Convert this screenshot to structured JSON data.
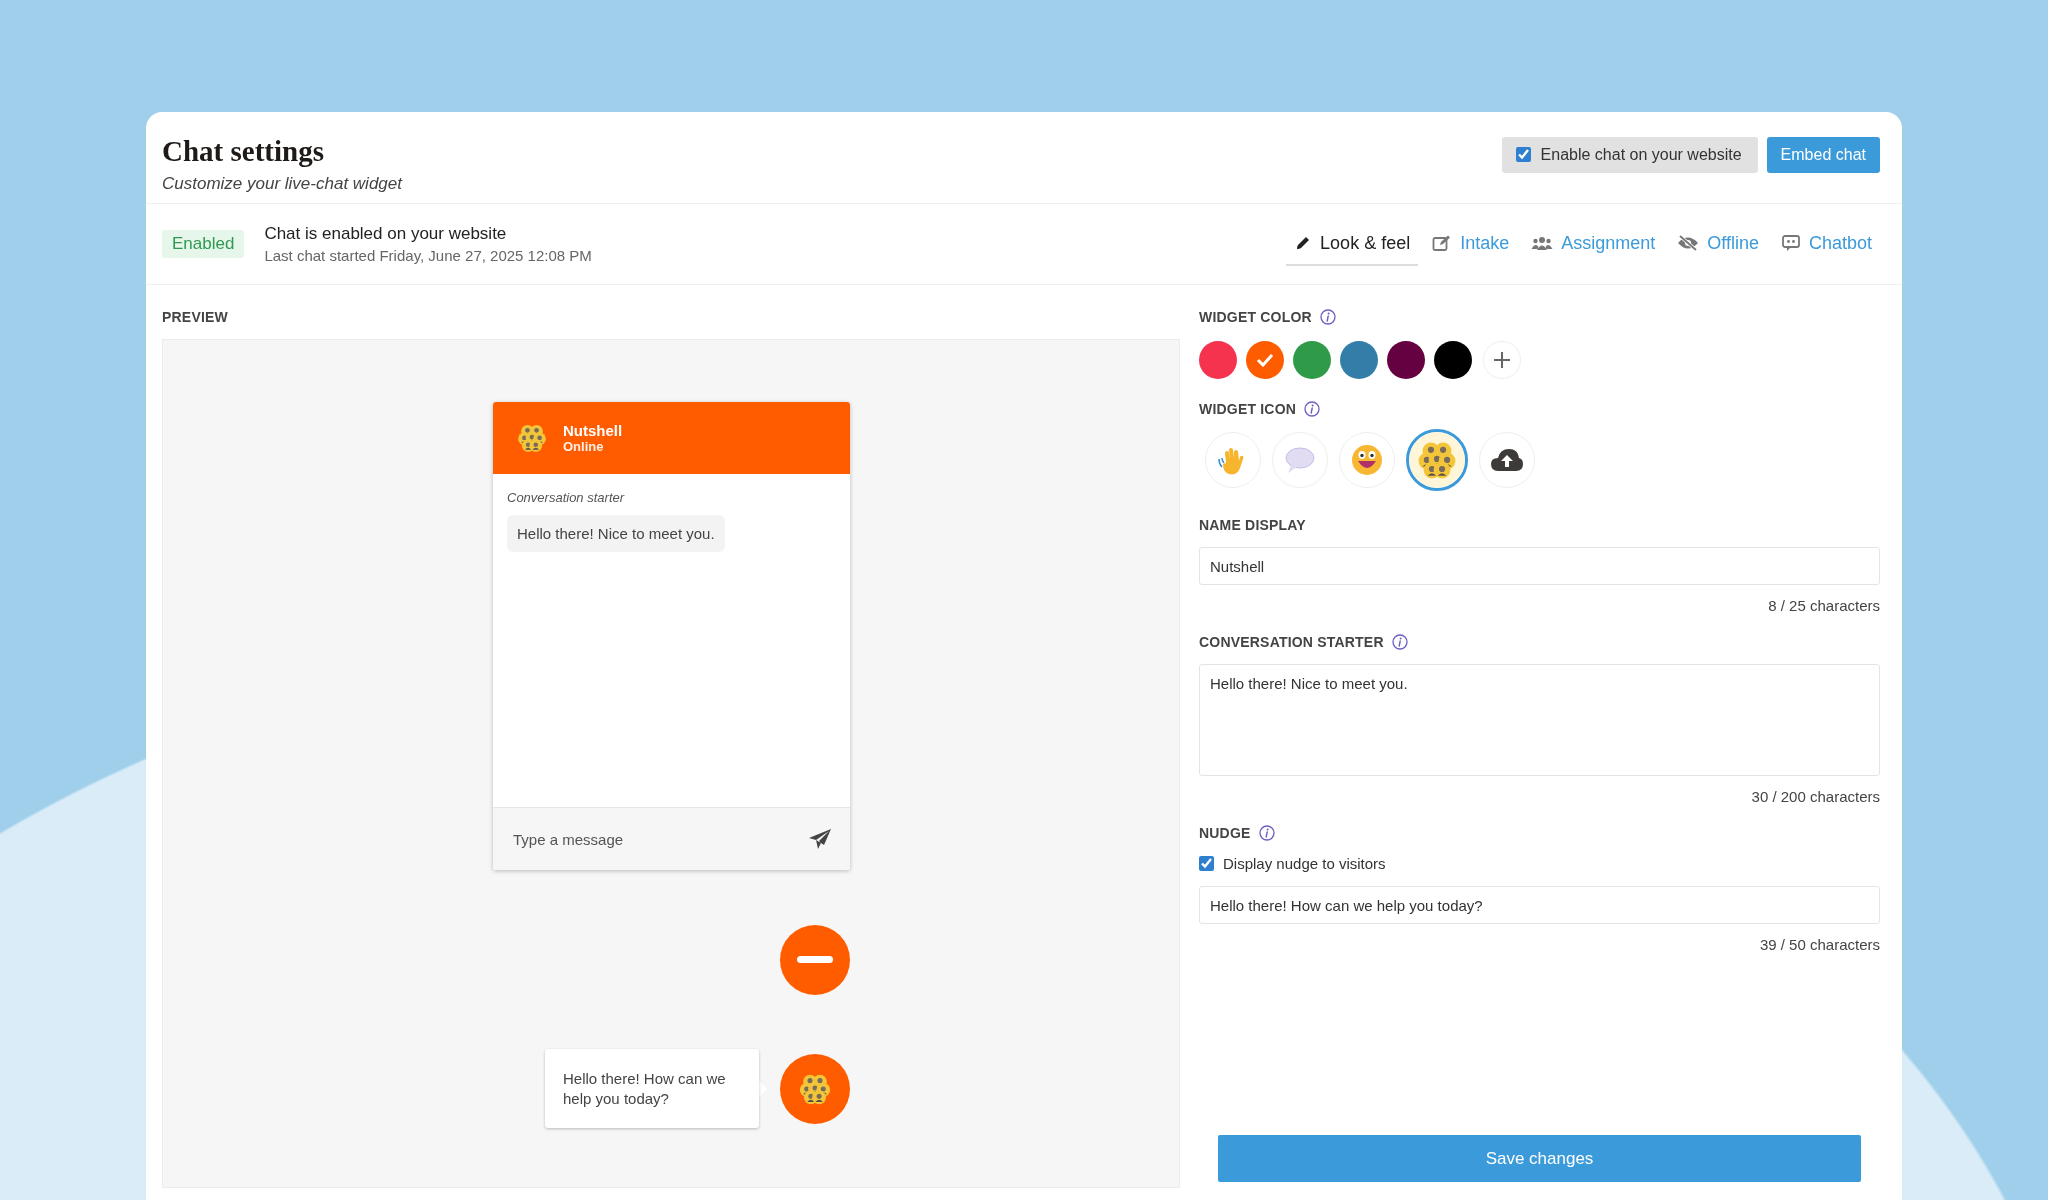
{
  "header": {
    "title": "Chat settings",
    "subtitle": "Customize your live-chat widget",
    "enable_checkbox": {
      "label": "Enable chat on your website",
      "checked": true
    },
    "embed_button": "Embed chat"
  },
  "status": {
    "badge": "Enabled",
    "message": "Chat is enabled on your website",
    "last_chat": "Last chat started Friday, June 27, 2025 12:08 PM"
  },
  "tabs": [
    {
      "label": "Look & feel",
      "kind": "pencil",
      "selected": true
    },
    {
      "label": "Intake",
      "kind": "form",
      "selected": false
    },
    {
      "label": "Assignment",
      "kind": "people",
      "selected": false
    },
    {
      "label": "Offline",
      "kind": "offline",
      "selected": false
    },
    {
      "label": "Chatbot",
      "kind": "bot",
      "selected": false
    }
  ],
  "preview": {
    "label": "PREVIEW",
    "widget": {
      "name": "Nutshell",
      "status": "Online",
      "starter_label": "Conversation starter",
      "starter_message": "Hello there! Nice to meet you.",
      "input_placeholder": "Type a message"
    },
    "nudge": "Hello there! How can we help you today?"
  },
  "settings": {
    "widget_color": {
      "label": "WIDGET COLOR",
      "swatches": [
        {
          "color": "#f5334f",
          "selected": false
        },
        {
          "color": "#ff5c00",
          "selected": true
        },
        {
          "color": "#2f9a47",
          "selected": false
        },
        {
          "color": "#337ea9",
          "selected": false
        },
        {
          "color": "#650140",
          "selected": false
        },
        {
          "color": "#000000",
          "selected": false
        }
      ]
    },
    "widget_icon": {
      "label": "WIDGET ICON",
      "options": [
        {
          "kind": "wave",
          "selected": false
        },
        {
          "kind": "bubble",
          "selected": false
        },
        {
          "kind": "smiley",
          "selected": false
        },
        {
          "kind": "team",
          "selected": true
        },
        {
          "kind": "upload",
          "selected": false
        }
      ]
    },
    "name_display": {
      "label": "NAME DISPLAY",
      "value": "Nutshell",
      "count": "8 / 25 characters"
    },
    "conversation_starter": {
      "label": "CONVERSATION STARTER",
      "value": "Hello there! Nice to meet you.",
      "count": "30 / 200 characters"
    },
    "nudge": {
      "label": "NUDGE",
      "checkbox": {
        "label": "Display nudge to visitors",
        "checked": true
      },
      "value": "Hello there! How can we help you today?",
      "count": "39 / 50 characters"
    }
  },
  "save_button": "Save changes"
}
